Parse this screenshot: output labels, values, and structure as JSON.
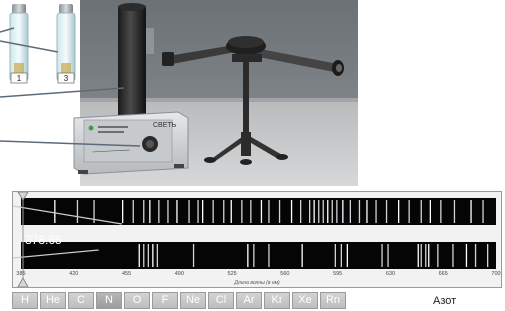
{
  "tubes": [
    {
      "label": "1"
    },
    {
      "label": "3"
    }
  ],
  "lamp": {
    "label": "СВЕТЬ"
  },
  "spectroscope": {
    "readout": "378.65",
    "axis_caption": "Длина волны (в нм)",
    "ticks": [
      "385",
      "420",
      "455",
      "490",
      "525",
      "560",
      "595",
      "630",
      "665",
      "700"
    ],
    "wavelength_range": [
      385,
      700
    ],
    "reference_lines_nm": [
      407,
      422,
      433,
      452,
      459,
      466,
      470,
      476,
      482,
      488,
      496,
      502,
      505,
      512,
      519,
      524,
      531,
      537,
      544,
      549,
      556,
      564,
      570,
      576,
      579,
      582,
      585,
      588,
      591,
      594,
      598,
      603,
      609,
      614,
      620,
      627,
      635,
      642,
      650,
      656,
      663,
      672,
      683,
      691
    ],
    "sample_lines_nm": [
      463,
      466,
      469,
      472,
      475,
      499,
      535,
      539,
      549,
      571,
      593,
      597,
      601,
      624,
      628,
      648,
      650,
      653,
      655,
      661,
      671,
      680,
      686,
      694
    ],
    "marker_nm": 378.65
  },
  "elements": [
    "H",
    "He",
    "C",
    "N",
    "O",
    "F",
    "Ne",
    "Cl",
    "Ar",
    "Kr",
    "Xe",
    "Rn"
  ],
  "selected_element": "Азот",
  "active_element": "N"
}
